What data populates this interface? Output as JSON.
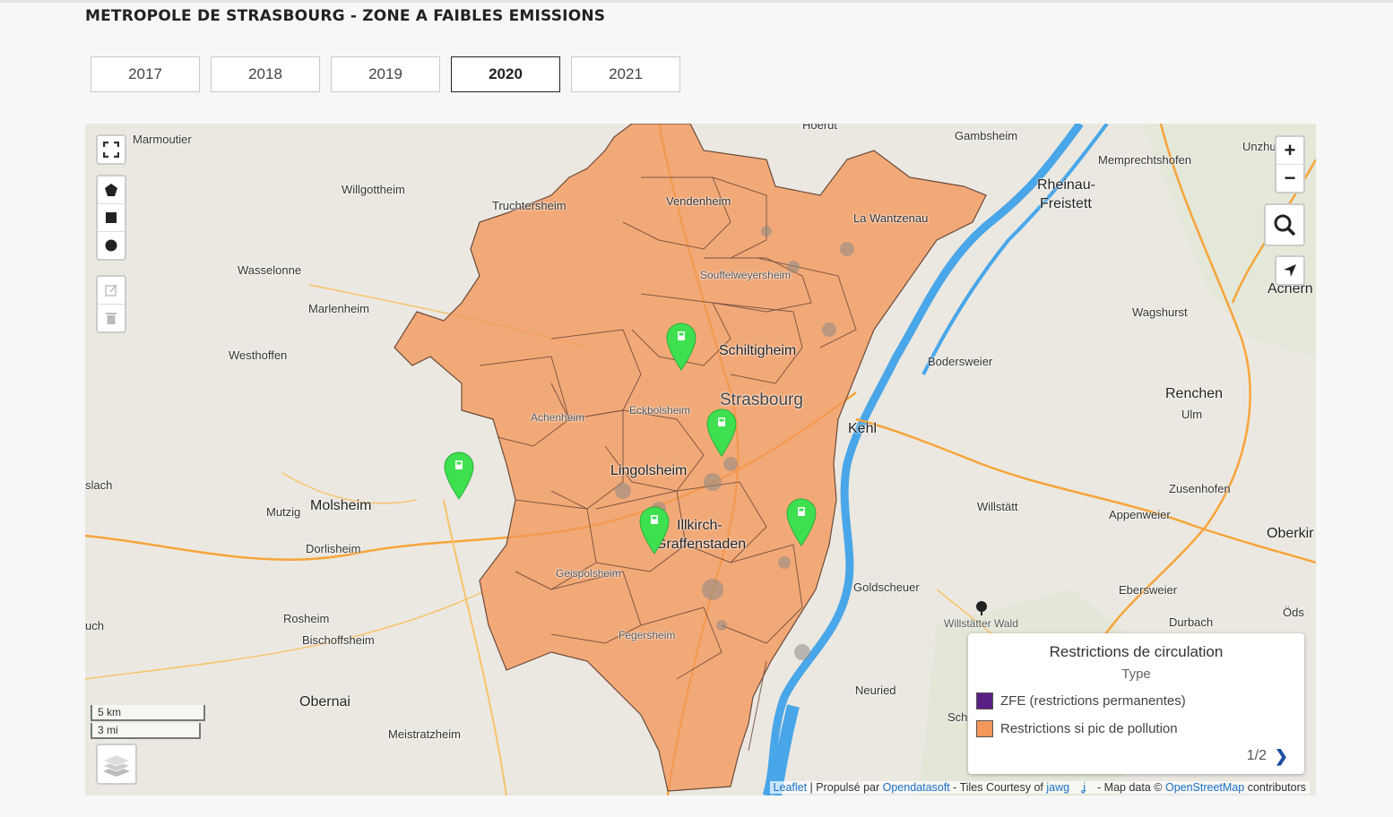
{
  "page": {
    "title": "METROPOLE DE STRASBOURG - ZONE A FAIBLES EMISSIONS"
  },
  "tabs": [
    {
      "label": "2017",
      "active": false
    },
    {
      "label": "2018",
      "active": false
    },
    {
      "label": "2019",
      "active": false
    },
    {
      "label": "2020",
      "active": true
    },
    {
      "label": "2021",
      "active": false
    }
  ],
  "map": {
    "labels": {
      "marmoutier": "Marmoutier",
      "willgottheim": "Willgottheim",
      "truchtersheim": "Truchtersheim",
      "vendenheim": "Vendenheim",
      "gambsheim": "Gambsheim",
      "memprechtshofen": "Memprechtshofen",
      "rheinau": "Rheinau-",
      "freistett": "Freistett",
      "unzhurst": "Unzhu",
      "lawantzenau": "La Wantzenau",
      "wasselonne": "Wasselonne",
      "marlenheim": "Marlenheim",
      "souffelweyersheim": "Souffelweyersheim",
      "achern": "Achern",
      "wagshurst": "Wagshurst",
      "westhoffen": "Westhoffen",
      "schiltigheim": "Schiltigheim",
      "bodersweier": "Bodersweier",
      "strasbourg": "Strasbourg",
      "renchen": "Renchen",
      "achenheim": "Achenheim",
      "eckbolsheim": "Eckbolsheim",
      "ulm": "Ulm",
      "kehl": "Kehl",
      "slach": "slach",
      "lingolsheim": "Lingolsheim",
      "zusenhofen": "Zusenhofen",
      "mutzig": "Mutzig",
      "molsheim": "Molsheim",
      "willstatt": "Willstätt",
      "appenweier": "Appenweier",
      "illkirch1": "Illkirch-",
      "illkirch2": "Graffenstaden",
      "dorlisheim": "Dorlisheim",
      "oberkirch": "Oberkir",
      "geispolsheim": "Geispolsheim",
      "goldscheuer": "Goldscheuer",
      "ebersweier": "Ebersweier",
      "rosheim": "Rosheim",
      "willstatterwald": "Willstätter Wald",
      "ods": "Öds",
      "durbach": "Durbach",
      "uch": "uch",
      "bischoffsheim": "Bischoffsheim",
      "fegersheim": "Fegersheim",
      "neuried": "Neuried",
      "obernai": "Obernai",
      "sch": "Sch",
      "meistratzheim": "Meistratzheim",
      "hoerdt": "Hoerdt"
    },
    "scale": {
      "km": "5 km",
      "mi": "3 mi"
    },
    "controls": {
      "zoom_in": "+",
      "zoom_out": "−"
    },
    "legend": {
      "title": "Restrictions de circulation",
      "subtitle": "Type",
      "items": [
        {
          "label": "ZFE (restrictions permanentes)",
          "color": "#5a1f82"
        },
        {
          "label": "Restrictions si pic de pollution",
          "color": "#f4975a"
        }
      ],
      "pager": "1/2",
      "next": "❯"
    },
    "attribution": {
      "leaflet": "Leaflet",
      "sep1": " | Propulsé par ",
      "ods": "Opendatasoft",
      "tiles": " - Tiles Courtesy of ",
      "jawg": "jawg",
      "mapdata": " - Map data © ",
      "osm": "OpenStreetMap",
      "contrib": " contributors"
    },
    "colors": {
      "zone": "#f4975a",
      "pin": "#3ee04f",
      "water": "#49a6e8"
    }
  }
}
